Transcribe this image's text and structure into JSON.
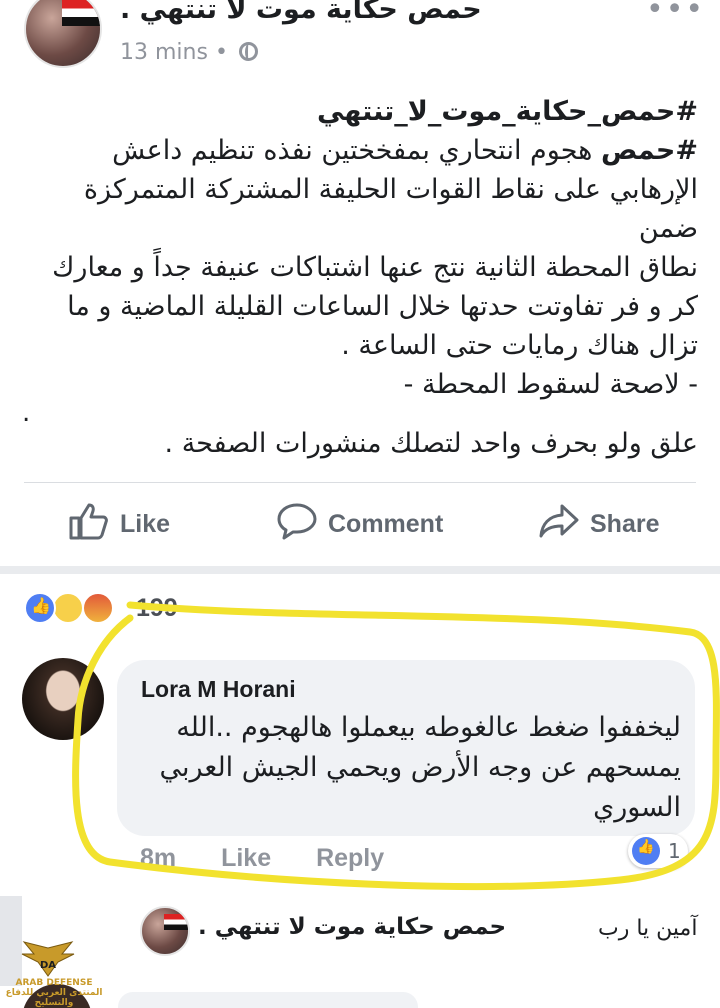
{
  "post": {
    "page_name": "حمص حكاية موت لا تنتهي .",
    "time": "13 mins",
    "time_separator": "•",
    "more_label": "•••",
    "body_title": "#حمص_حكاية_موت_لا_تنتهي",
    "body_hashtag": "#حمص",
    "body_lines": [
      "هجوم انتحاري بمفخختين نفذه تنظيم داعش",
      "الإرهابي على نقاط القوات الحليفة المشتركة المتمركزة ضمن",
      "نطاق المحطة الثانية نتج عنها اشتباكات عنيفة جداً و معارك",
      "كر و فر تفاوتت حدتها خلال الساعات القليلة الماضية و ما",
      "تزال هناك رمايات حتى الساعة .",
      "- لاصحة لسقوط المحطة -"
    ],
    "stray_dot": ".",
    "footer_line": "علق ولو بحرف واحد لتصلك منشورات الصفحة ."
  },
  "actions": {
    "like": "Like",
    "comment": "Comment",
    "share": "Share"
  },
  "reactions": {
    "count": "199",
    "types": [
      "like",
      "sad",
      "angry"
    ]
  },
  "comment": {
    "author": "Lora M Horani",
    "text": "ليخففوا ضغط عالغوطه بيعملوا هالهجوم ..الله يمسحهم عن وجه الأرض ويحمي الجيش العربي السوري",
    "time": "8m",
    "like_label": "Like",
    "reply_label": "Reply",
    "like_count": "1"
  },
  "reply": {
    "author": "حمص حكاية موت لا تنتهي .",
    "text": "آمين يا رب"
  },
  "watermark": {
    "letters": "DA",
    "line1": "ARAB DEFENSE",
    "line2": "المنتدى العربي للدفاع والتسليح"
  },
  "colors": {
    "facebook_blue": "#4f7ef3",
    "annotation_yellow": "#f2e22e",
    "meta_gray": "#90949c"
  }
}
